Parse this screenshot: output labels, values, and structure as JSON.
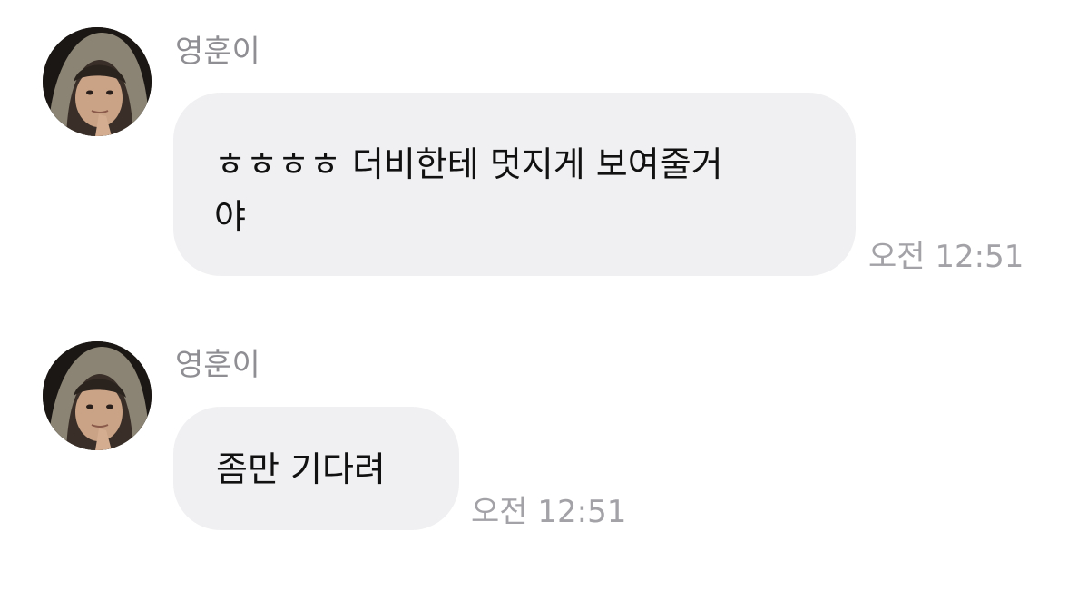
{
  "messages": [
    {
      "sender": "영훈이",
      "text": "ㅎㅎㅎㅎ 더비한테 멋지게 보여줄거\n야",
      "time": "오전 12:51",
      "avatar": "profile-photo"
    },
    {
      "sender": "영훈이",
      "text": "좀만 기다려",
      "time": "오전 12:51",
      "avatar": "profile-photo"
    }
  ],
  "colors": {
    "bubble_bg": "#f0f0f2",
    "sender_text": "#8e8e93",
    "timestamp_text": "#a2a2a7",
    "message_text": "#111111"
  }
}
